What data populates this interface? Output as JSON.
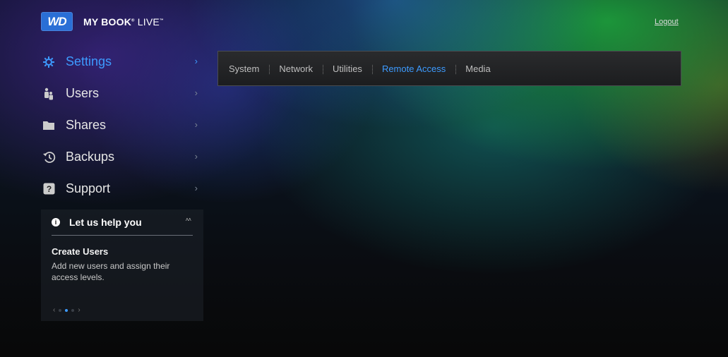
{
  "header": {
    "logo_text": "WD",
    "product_name": "MY BOOK",
    "product_suffix": "LIVE",
    "reg_mark": "®",
    "tm_mark": "™",
    "logout_label": "Logout"
  },
  "nav": {
    "items": [
      {
        "label": "Settings",
        "icon": "gear-icon",
        "active": true
      },
      {
        "label": "Users",
        "icon": "users-icon"
      },
      {
        "label": "Shares",
        "icon": "folder-icon"
      },
      {
        "label": "Backups",
        "icon": "backup-clock-icon"
      },
      {
        "label": "Support",
        "icon": "question-icon"
      }
    ]
  },
  "help": {
    "title": "Let us help you",
    "subtitle": "Create Users",
    "text": "Add new users and assign their access levels.",
    "collapse_glyph": "˄˄",
    "page_count": 3,
    "active_page": 2
  },
  "tabs": {
    "items": [
      "System",
      "Network",
      "Utilities",
      "Remote Access",
      "Media"
    ],
    "active": "Remote Access"
  },
  "colors": {
    "accent": "#3d9bff",
    "logo_blue": "#2a6fd6"
  }
}
